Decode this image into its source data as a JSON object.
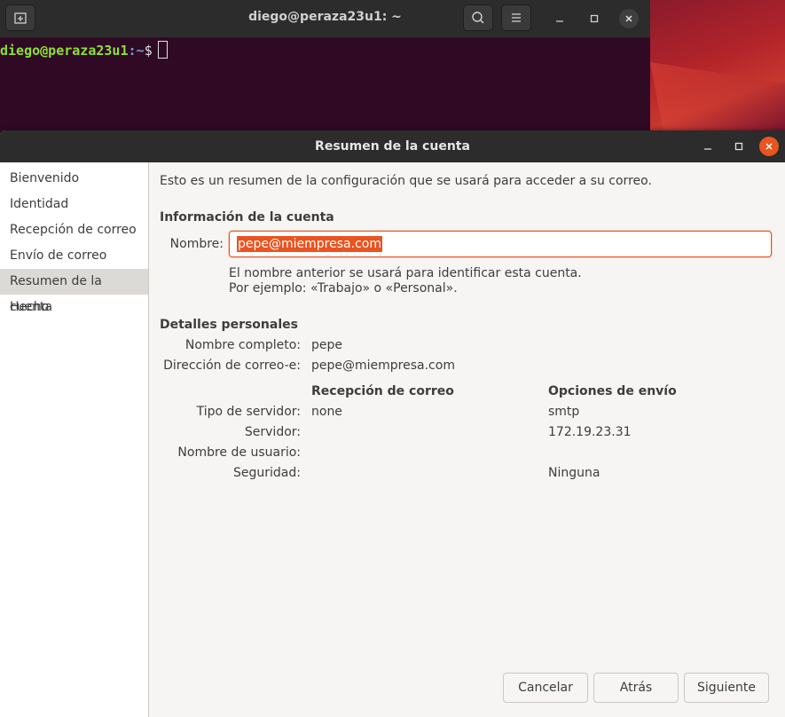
{
  "terminal": {
    "title": "diego@peraza23u1: ~",
    "prompt_user": "diego@peraza23u1",
    "prompt_path": ":~",
    "prompt_symbol": "$"
  },
  "dialog": {
    "title": "Resumen de la cuenta",
    "sidebar": {
      "items": [
        {
          "label": "Bienvenido"
        },
        {
          "label": "Identidad"
        },
        {
          "label": "Recepción de correo"
        },
        {
          "label": "Envío de correo"
        },
        {
          "label": "Resumen de la cuenta",
          "active": true
        },
        {
          "label": "Hecho"
        }
      ]
    },
    "intro": "Esto es un resumen de la configuración que se usará para acceder a su correo.",
    "account_info": {
      "heading": "Información de la cuenta",
      "name_label": "Nombre:",
      "name_value": "pepe@miempresa.com",
      "hint_line1": "El nombre anterior se usará para identificar esta cuenta.",
      "hint_line2": "Por ejemplo: «Trabajo» o «Personal»."
    },
    "personal": {
      "heading": "Detalles personales",
      "fullname_label": "Nombre completo:",
      "fullname_value": "pepe",
      "email_label": "Dirección de correo-e:",
      "email_value": "pepe@miempresa.com"
    },
    "servers": {
      "receive_heading": "Recepción de correo",
      "send_heading": "Opciones de envío",
      "rows": [
        {
          "label": "Tipo de servidor:",
          "receive": "none",
          "send": "smtp"
        },
        {
          "label": "Servidor:",
          "receive": "",
          "send": "172.19.23.31"
        },
        {
          "label": "Nombre de usuario:",
          "receive": "",
          "send": ""
        },
        {
          "label": "Seguridad:",
          "receive": "",
          "send": "Ninguna"
        }
      ]
    },
    "buttons": {
      "cancel": "Cancelar",
      "back": "Atrás",
      "next": "Siguiente"
    }
  },
  "colors": {
    "accent": "#e95420",
    "terminal_bg": "#300a24",
    "titlebar": "#2c2c2c",
    "prompt_user": "#8ae234",
    "prompt_path": "#729fcf"
  },
  "icons": [
    "new-tab-icon",
    "search-icon",
    "hamburger-menu-icon",
    "minimize-icon",
    "maximize-icon",
    "close-icon"
  ]
}
